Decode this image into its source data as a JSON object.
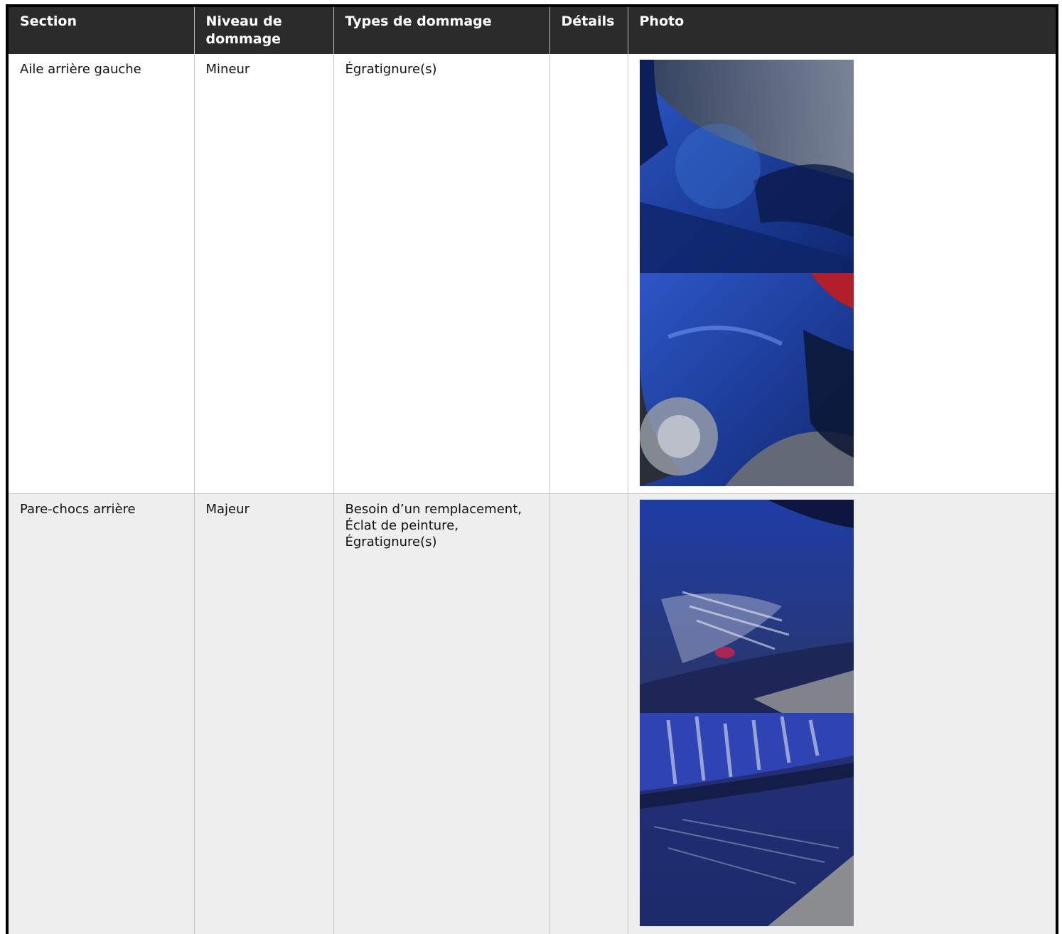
{
  "table": {
    "headers": [
      "Section",
      "Niveau de dommage",
      "Types de dommage",
      "Détails",
      "Photo"
    ],
    "rows": [
      {
        "section": "Aile arrière gauche",
        "niveau": "Mineur",
        "types": [
          "Égratignure(s)"
        ],
        "details": "",
        "photos": [
          "car-fender-photo",
          "car-rear-quarter-photo"
        ]
      },
      {
        "section": "Pare-chocs arrière",
        "niveau": "Majeur",
        "types": [
          "Besoin d’un remplacement,",
          "Éclat de peinture,",
          "Égratignure(s)"
        ],
        "details": "",
        "photos": [
          "bumper-scratch-photo",
          "bumper-scuff-photo"
        ]
      }
    ]
  },
  "colors": {
    "header_bg": "#2b2b2b",
    "row_alt_bg": "#eeeeee",
    "car_blue": "#1f3f9e"
  }
}
